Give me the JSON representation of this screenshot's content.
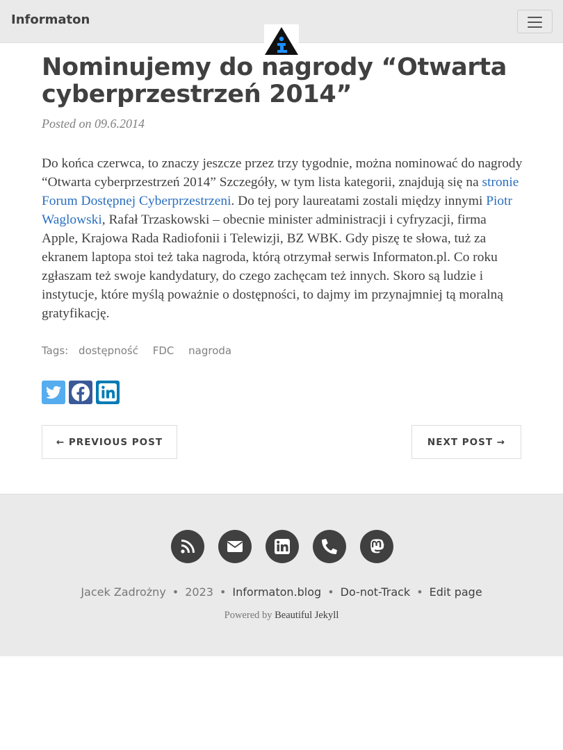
{
  "navbar": {
    "brand": "Informaton",
    "menu_icon": "hamburger-menu-icon",
    "avatar_icon": "informaton-logo"
  },
  "post": {
    "title": "Nominujemy do nagrody “Otwarta cyberprzestrzeń 2014”",
    "meta": "Posted on 09.6.2014",
    "body": {
      "p1": "Do końca czerwca, to znaczy jeszcze przez trzy tygodnie, można nominować do nagrody “Otwarta cyberprzestrzeń 2014” Szczegóły, w tym lista kategorii, znajdują się na ",
      "link1": "stronie Forum Dostępnej Cyberprzestrzeni",
      "p2": ". Do tej pory laureatami zostali między innymi ",
      "link2": "Piotr Waglowski",
      "p3": ", Rafał Trzaskowski – obecnie minister administracji i cyfryzacji, firma Apple, Krajowa Rada Radiofonii i Telewizji, BZ WBK. Gdy piszę te słowa, tuż za ekranem laptopa stoi też taka nagroda, którą otrzymał serwis Informaton.pl. Co roku zgłaszam też swoje kandydatury, do czego zachęcam też innych. Skoro są ludzie i instytucje, które myślą poważnie o dostępności, to dajmy im przynajmniej tą moralną gratyfikację."
    },
    "tags_label": "Tags:",
    "tags": [
      "dostępność",
      "FDC",
      "nagroda"
    ],
    "share": [
      {
        "icon": "twitter-icon",
        "color": "#55acee"
      },
      {
        "icon": "facebook-icon",
        "color": "#3b5998"
      },
      {
        "icon": "linkedin-icon",
        "color": "#007bb5"
      }
    ],
    "prev_label": "← PREVIOUS POST",
    "next_label": "NEXT POST →"
  },
  "footer": {
    "social": [
      "rss-icon",
      "envelope-icon",
      "linkedin-icon",
      "phone-icon",
      "mastodon-icon"
    ],
    "author": "Jacek Zadrożny",
    "year": "2023",
    "site": "Informaton.blog",
    "dnt": "Do-not-Track",
    "edit": "Edit page",
    "powered_prefix": "Powered by ",
    "powered_link": "Beautiful Jekyll"
  },
  "colors": {
    "navbar_bg": "#eaeaea",
    "footer_bg": "#eaeaea",
    "link": "#2a6fc0",
    "text": "#404040"
  }
}
